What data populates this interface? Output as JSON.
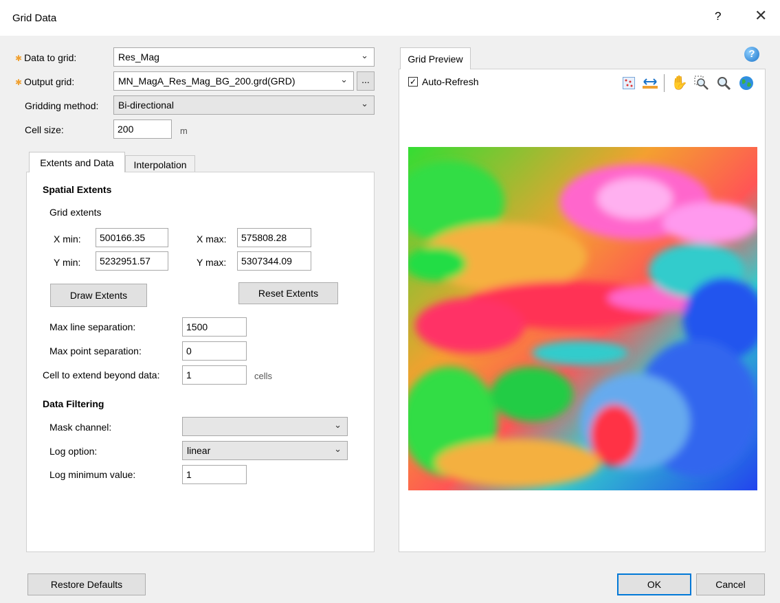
{
  "window": {
    "title": "Grid Data",
    "help_glyph": "?",
    "close_glyph": "✕"
  },
  "fields": {
    "data_to_grid": {
      "label": "Data to grid:",
      "value": "Res_Mag"
    },
    "output_grid": {
      "label": "Output grid:",
      "value": "MN_MagA_Res_Mag_BG_200.grd(GRD)",
      "browse": "..."
    },
    "gridding_method": {
      "label": "Gridding method:",
      "value": "Bi-directional"
    },
    "cell_size": {
      "label": "Cell size:",
      "value": "200",
      "unit": "m"
    }
  },
  "tabs": {
    "extents": "Extents and Data",
    "interpolation": "Interpolation"
  },
  "spatial": {
    "heading": "Spatial Extents",
    "grid_extents": "Grid extents",
    "xmin_label": "X min:",
    "xmin": "500166.35",
    "xmax_label": "X max:",
    "xmax": "575808.28",
    "ymin_label": "Y min:",
    "ymin": "5232951.57",
    "ymax_label": "Y max:",
    "ymax": "5307344.09",
    "draw_button": "Draw Extents",
    "reset_button": "Reset Extents"
  },
  "separation": {
    "max_line_label": "Max line separation:",
    "max_line": "1500",
    "max_point_label": "Max point separation:",
    "max_point": "0",
    "extend_label": "Cell to extend beyond data:",
    "extend": "1",
    "extend_unit": "cells"
  },
  "filtering": {
    "heading": "Data Filtering",
    "mask_label": "Mask channel:",
    "mask_value": "",
    "log_option_label": "Log option:",
    "log_option": "linear",
    "log_min_label": "Log minimum value:",
    "log_min": "1"
  },
  "preview": {
    "tab": "Grid Preview",
    "auto_refresh": "Auto-Refresh",
    "auto_refresh_checked": true
  },
  "footer": {
    "restore": "Restore Defaults",
    "ok": "OK",
    "cancel": "Cancel"
  },
  "colors": {
    "accent": "#0078d7",
    "required_star": "#f0a030"
  }
}
